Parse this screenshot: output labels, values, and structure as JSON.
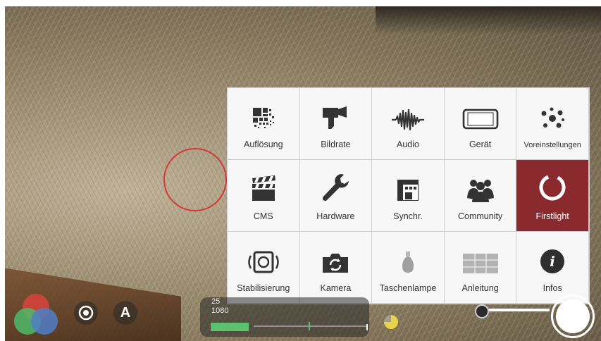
{
  "menu": {
    "items": [
      {
        "label": "Auflösung",
        "icon": "resolution-grid-icon"
      },
      {
        "label": "Bildrate",
        "icon": "movie-camera-icon"
      },
      {
        "label": "Audio",
        "icon": "audio-waveform-icon"
      },
      {
        "label": "Gerät",
        "icon": "phone-device-icon"
      },
      {
        "label": "Voreinstellungen",
        "icon": "presets-molecule-icon"
      },
      {
        "label": "CMS",
        "icon": "clapperboard-icon"
      },
      {
        "label": "Hardware",
        "icon": "wrench-icon"
      },
      {
        "label": "Synchr.",
        "icon": "sync-icon"
      },
      {
        "label": "Community",
        "icon": "community-people-icon"
      },
      {
        "label": "Firstlight",
        "icon": "firstlight-ring-icon",
        "active": true
      },
      {
        "label": "Stabilisierung",
        "icon": "stabilization-icon"
      },
      {
        "label": "Kamera",
        "icon": "camera-flip-icon"
      },
      {
        "label": "Taschenlampe",
        "icon": "flashlight-bulb-icon"
      },
      {
        "label": "Anleitung",
        "icon": "guide-grid-icon"
      },
      {
        "label": "Infos",
        "icon": "info-icon"
      }
    ]
  },
  "status": {
    "fps": "25",
    "resolution": "1080"
  },
  "colors": {
    "active_tile": "#8b2a2e",
    "focus_ring": "#d53a3a",
    "storage_bar": "#5dc06d",
    "battery": "#e9d34a"
  },
  "controls": {
    "auto_label": "A"
  }
}
